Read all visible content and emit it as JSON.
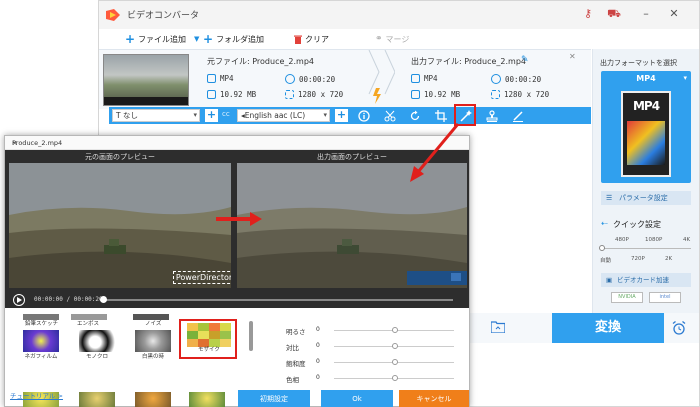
{
  "app": {
    "title": "ビデオコンバータ"
  },
  "toolbar": {
    "add_file": "ファイル追加",
    "add_folder": "フォルダ追加",
    "clear": "クリア",
    "merge": "マージ"
  },
  "file": {
    "source_label": "元ファイル: Produce_2.mp4",
    "output_label": "出力ファイル: Produce_2.mp4",
    "src_format": "MP4",
    "src_duration": "00:00:20",
    "src_size": "10.92 MB",
    "src_resolution": "1280 x 720",
    "out_format": "MP4",
    "out_duration": "00:00:20",
    "out_size": "10.92 MB",
    "out_resolution": "1280 x 720"
  },
  "options": {
    "subtitle": "なし",
    "audio": "English aac (LC)"
  },
  "right_panel": {
    "title": "出力フォーマットを選択",
    "format": "MP4",
    "format_icon_text": "MP4",
    "param_button": "パラメータ設定",
    "quick_label": "クイック設定",
    "quality_top": [
      "480P",
      "1080P",
      "4K"
    ],
    "quality_bottom": [
      "自動",
      "720P",
      "2K"
    ],
    "gpu_button": "ビデオカード加速",
    "gpu_brands": [
      "NVIDIA",
      "intel"
    ]
  },
  "convert": {
    "label": "変換"
  },
  "dialog": {
    "title": "Produce_2.mp4",
    "source_preview": "元の画面のプレビュー",
    "output_preview": "出力画面のプレビュー",
    "watermark": "PowerDirector",
    "time": "00:00:00 / 00:00:20",
    "effects": [
      {
        "label": "鉛筆スケッチ"
      },
      {
        "label": "エンボス"
      },
      {
        "label": "ノイズ"
      },
      {
        "label": "モザイク"
      },
      {
        "label": "ネガフィルム"
      },
      {
        "label": "モノクロ"
      },
      {
        "label": "白黒の時"
      },
      {
        "label": ""
      },
      {
        "label": ""
      },
      {
        "label": ""
      },
      {
        "label": ""
      }
    ],
    "adjust": [
      {
        "label": "明るさ",
        "value": "0"
      },
      {
        "label": "対比",
        "value": "0"
      },
      {
        "label": "飽和度",
        "value": "0"
      },
      {
        "label": "色相",
        "value": "0"
      }
    ],
    "tutorial": "チュートリアル >",
    "reset": "初期設定",
    "ok": "Ok",
    "cancel": "キャンセル"
  },
  "colors": {
    "accent": "#30a0ee",
    "highlight": "#e0201c",
    "cancel": "#f07f1a"
  }
}
